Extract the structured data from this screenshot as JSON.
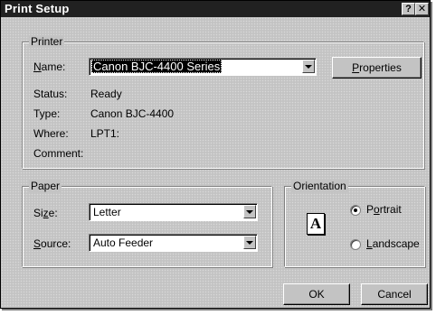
{
  "window": {
    "title": "Print Setup",
    "help_button": "?",
    "close_button": "✕"
  },
  "printer": {
    "group_label": "Printer",
    "name_label": "Name:",
    "name_mnemonic_index": 0,
    "name_value": "Canon BJC-4400 Series",
    "properties_button": "Properties",
    "properties_mnemonic_index": 0,
    "status_label": "Status:",
    "status_value": "Ready",
    "type_label": "Type:",
    "type_value": "Canon  BJC-4400",
    "where_label": "Where:",
    "where_value": "LPT1:",
    "comment_label": "Comment:",
    "comment_value": ""
  },
  "paper": {
    "group_label": "Paper",
    "size_label": "Size:",
    "size_mnemonic_index": 2,
    "size_value": "Letter",
    "source_label": "Source:",
    "source_mnemonic_index": 0,
    "source_value": "Auto Feeder"
  },
  "orientation": {
    "group_label": "Orientation",
    "page_glyph": "A",
    "portrait_label": "Portrait",
    "portrait_mnemonic_index": 1,
    "portrait_selected": true,
    "landscape_label": "Landscape",
    "landscape_mnemonic_index": 0,
    "landscape_selected": false
  },
  "buttons": {
    "ok": "OK",
    "cancel": "Cancel"
  }
}
